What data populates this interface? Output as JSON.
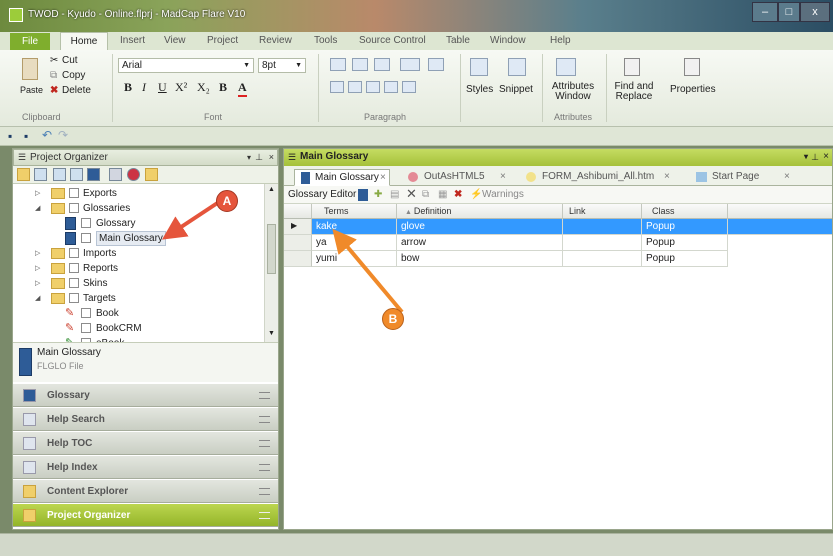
{
  "window": {
    "title": "TWOD - Kyudo - Online.flprj - MadCap Flare V10"
  },
  "ribbon_tabs": [
    "File",
    "Home",
    "Insert",
    "View",
    "Project",
    "Review",
    "Tools",
    "Source Control",
    "Table",
    "Window",
    "Help"
  ],
  "clipboard": {
    "cut": "Cut",
    "copy": "Copy",
    "paste": "Paste",
    "delete": "Delete",
    "label": "Clipboard"
  },
  "font": {
    "family": "Arial",
    "size": "8pt",
    "label": "Font"
  },
  "paragraph": {
    "label": "Paragraph"
  },
  "styles": {
    "styles": "Styles",
    "snippet": "Snippet"
  },
  "attributes": {
    "window": "Attributes Window",
    "label": "Attributes"
  },
  "find": {
    "find": "Find and Replace",
    "properties": "Properties"
  },
  "organizer": {
    "title": "Project Organizer",
    "tree": [
      {
        "label": "Exports",
        "expander": "▷"
      },
      {
        "label": "Glossaries",
        "expander": "◢"
      },
      {
        "label": "Glossary"
      },
      {
        "label": "Main Glossary"
      },
      {
        "label": "Imports",
        "expander": "▷"
      },
      {
        "label": "Reports",
        "expander": "▷"
      },
      {
        "label": "Skins",
        "expander": "▷"
      },
      {
        "label": "Targets",
        "expander": "◢"
      },
      {
        "label": "Book"
      },
      {
        "label": "BookCRM"
      },
      {
        "label": "eBook"
      }
    ],
    "selected": {
      "name": "Main Glossary",
      "type": "FLGLO File"
    },
    "nav": [
      "Glossary",
      "Help Search",
      "Help TOC",
      "Help Index",
      "Content Explorer",
      "Project Organizer"
    ]
  },
  "main": {
    "title": "Main Glossary",
    "tabs": [
      "Main Glossary",
      "OutAsHTML5",
      "FORM_Ashibumi_All.htm",
      "Start Page"
    ],
    "tab_close": "×",
    "editor_label": "Glossary Editor",
    "warnings": "Warnings",
    "columns": [
      "Terms",
      "Definition",
      "Link",
      "Class"
    ],
    "rows": [
      {
        "term": "kake",
        "definition": "glove",
        "link": "",
        "class": "Popup"
      },
      {
        "term": "ya",
        "definition": "arrow",
        "link": "",
        "class": "Popup"
      },
      {
        "term": "yumi",
        "definition": "bow",
        "link": "",
        "class": "Popup"
      }
    ]
  },
  "callouts": {
    "a": "A",
    "b": "B"
  },
  "colors": {
    "accent": "#a5c13a",
    "selection": "#3399ff",
    "callout": "#e5553c"
  }
}
